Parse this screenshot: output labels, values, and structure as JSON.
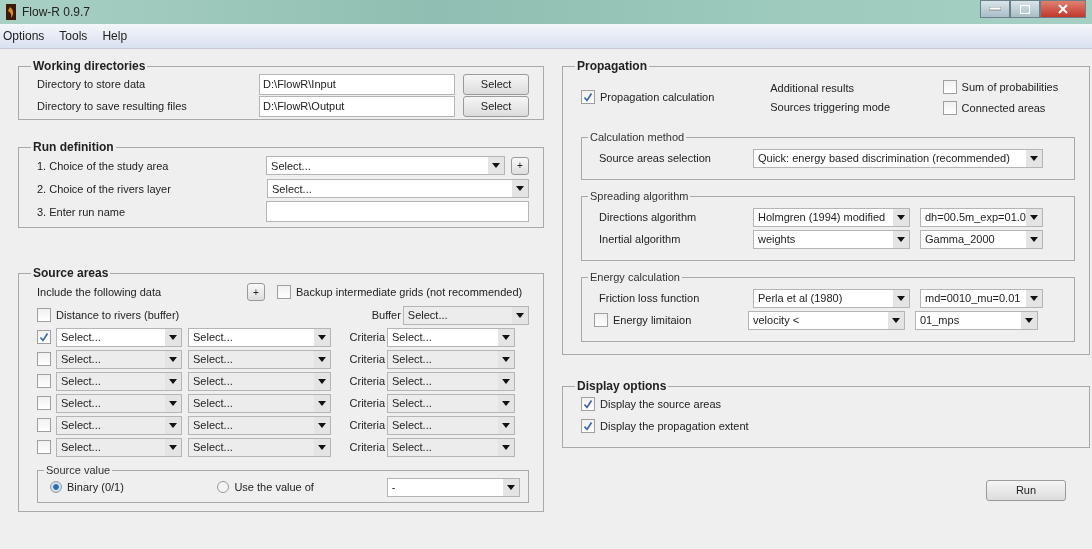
{
  "window": {
    "title": "Flow-R 0.9.7"
  },
  "menu": [
    "Options",
    "Tools",
    "Help"
  ],
  "working_directories": {
    "title": "Working directories",
    "rows": [
      {
        "label": "Directory to store data",
        "value": "D:\\FlowR\\Input",
        "button": "Select"
      },
      {
        "label": "Directory to save resulting files",
        "value": "D:\\FlowR\\Output",
        "button": "Select"
      }
    ]
  },
  "run_definition": {
    "title": "Run definition",
    "rows": [
      {
        "kind": "dropdown_add",
        "label": "1. Choice of the study area",
        "value": "Select...",
        "button": "+"
      },
      {
        "kind": "dropdown",
        "label": "2. Choice of the rivers layer",
        "value": "Select..."
      },
      {
        "kind": "input",
        "label": "3. Enter run name"
      }
    ]
  },
  "source_areas": {
    "title": "Source areas",
    "include_label": "Include the following data",
    "add_button": "+",
    "backup": {
      "label": "Backup intermediate grids (not recommended)",
      "checked": false
    },
    "distance": {
      "label": "Distance to rivers (buffer)",
      "checked": false,
      "buffer_label": "Buffer",
      "buffer_value": "Select..."
    },
    "rows": [
      {
        "checked": true,
        "field_1": "Select...",
        "field_2": "Select...",
        "criteria_label": "Criteria",
        "criteria_value": "Select..."
      },
      {
        "checked": false,
        "field_1": "Select...",
        "field_2": "Select...",
        "criteria_label": "Criteria",
        "criteria_value": "Select..."
      },
      {
        "checked": false,
        "field_1": "Select...",
        "field_2": "Select...",
        "criteria_label": "Criteria",
        "criteria_value": "Select..."
      },
      {
        "checked": false,
        "field_1": "Select...",
        "field_2": "Select...",
        "criteria_label": "Criteria",
        "criteria_value": "Select..."
      },
      {
        "checked": false,
        "field_1": "Select...",
        "field_2": "Select...",
        "criteria_label": "Criteria",
        "criteria_value": "Select..."
      },
      {
        "checked": false,
        "field_1": "Select...",
        "field_2": "Select...",
        "criteria_label": "Criteria",
        "criteria_value": "Select..."
      }
    ],
    "source_value": {
      "title": "Source value",
      "options": [
        {
          "label": "Binary (0/1)",
          "selected": true
        },
        {
          "label": "Use the value of",
          "selected": false
        }
      ],
      "value": "-"
    }
  },
  "propagation": {
    "title": "Propagation",
    "calculation": {
      "label": "Propagation calculation",
      "checked": true
    },
    "additional_label": "Additional results",
    "triggering_label": "Sources triggering mode",
    "sum_of_probabilities": {
      "label": "Sum of probabilities",
      "checked": false
    },
    "connected_areas": {
      "label": "Connected areas",
      "checked": false
    },
    "groups": [
      {
        "title": "Calculation method",
        "rows": [
          {
            "kind": "label",
            "label": "Source areas selection",
            "fields": [
              "Quick: energy based discrimination (recommended)"
            ]
          }
        ]
      },
      {
        "title": "Spreading algorithm",
        "rows": [
          {
            "kind": "label",
            "label": "Directions algorithm",
            "fields": [
              "Holmgren (1994) modified",
              "dh=00.5m_exp=01.0"
            ]
          },
          {
            "kind": "label",
            "label": "Inertial algorithm",
            "fields": [
              "weights",
              "Gamma_2000"
            ]
          }
        ]
      },
      {
        "title": "Energy calculation",
        "rows": [
          {
            "kind": "label",
            "label": "Friction loss function",
            "fields": [
              "Perla et al (1980)",
              "md=0010_mu=0.01"
            ]
          },
          {
            "kind": "checkbox",
            "label": "Energy limitaion",
            "checked": false,
            "fields": [
              "velocity <",
              "01_mps"
            ]
          }
        ]
      }
    ]
  },
  "display_options": {
    "title": "Display options",
    "items": [
      {
        "label": "Display the source areas",
        "checked": true
      },
      {
        "label": "Display the propagation extent",
        "checked": true
      }
    ]
  },
  "run_button": "Run"
}
